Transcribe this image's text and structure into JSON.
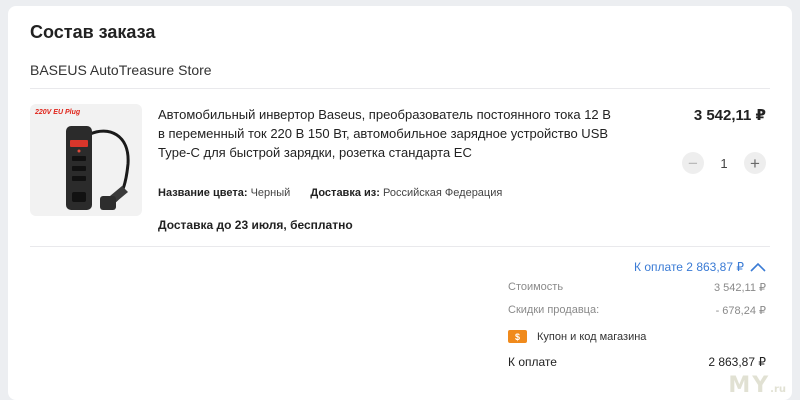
{
  "section_title": "Состав заказа",
  "store_name": "BASEUS AutoTreasure Store",
  "item": {
    "image_label": "220V EU Plug",
    "description": "Автомобильный инвертор Baseus, преобразователь постоянного тока 12 В в переменный ток 220 В 150 Вт, автомобильное зарядное устройство USB Type-C для быстрой зарядки, розетка стандарта ЕС",
    "color_label": "Название цвета:",
    "color_value": "Черный",
    "ship_from_label": "Доставка из:",
    "ship_from_value": "Российская Федерация",
    "delivery": "Доставка до 23 июля, бесплатно",
    "price": "3 542,11 ₽",
    "quantity": "1",
    "minus": "−",
    "plus": "+"
  },
  "summary": {
    "toggle_label": "К оплате 2 863,87 ₽",
    "cost_label": "Стоимость",
    "cost_value": "3 542,11 ₽",
    "discount_label": "Скидки продавца:",
    "discount_value": "- 678,24 ₽",
    "coupon_icon_text": "$",
    "coupon_label": "Купон и код магазина",
    "total_label": "К оплате",
    "total_value": "2 863,87 ₽"
  },
  "watermark": {
    "main": "MY",
    "suffix": ".ru"
  },
  "colors": {
    "accent": "#3a7bd5",
    "coupon": "#f08a1c",
    "plug_label": "#e0241a"
  }
}
